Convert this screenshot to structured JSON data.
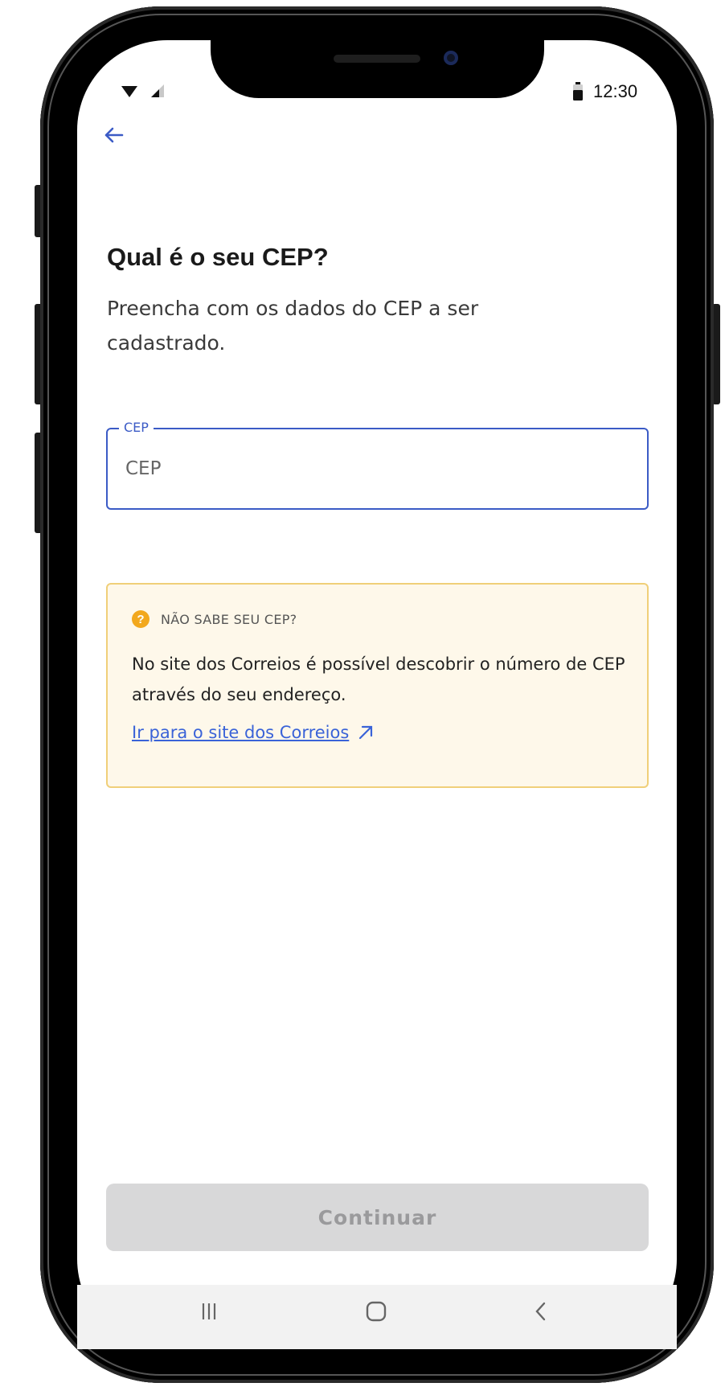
{
  "status_bar": {
    "time": "12:30",
    "icons": [
      "wifi-icon",
      "signal-icon",
      "battery-icon"
    ]
  },
  "header": {
    "back_icon": "arrow-left-icon"
  },
  "main": {
    "title": "Qual é o seu CEP?",
    "subtitle": "Preencha com os dados do CEP a ser cadastrado."
  },
  "cep_field": {
    "label": "CEP",
    "placeholder": "CEP",
    "value": ""
  },
  "info_card": {
    "title": "NÃO SABE SEU CEP?",
    "body": "No site dos Correios é possível descobrir o número de CEP através do seu endereço.",
    "link_text": "Ir para o site dos Correios",
    "icon": "question-icon",
    "link_icon": "external-link-icon"
  },
  "actions": {
    "continue_label": "Continuar",
    "continue_enabled": false
  },
  "navbar": {
    "icons": [
      "recents-icon",
      "home-icon",
      "back-icon"
    ]
  },
  "colors": {
    "accent": "#3b5bc6",
    "link": "#3a63d8",
    "info_bg": "#fef8ea",
    "info_border": "#f0cf79",
    "info_icon": "#f2a81d",
    "disabled_button": "#d8d8d9"
  }
}
